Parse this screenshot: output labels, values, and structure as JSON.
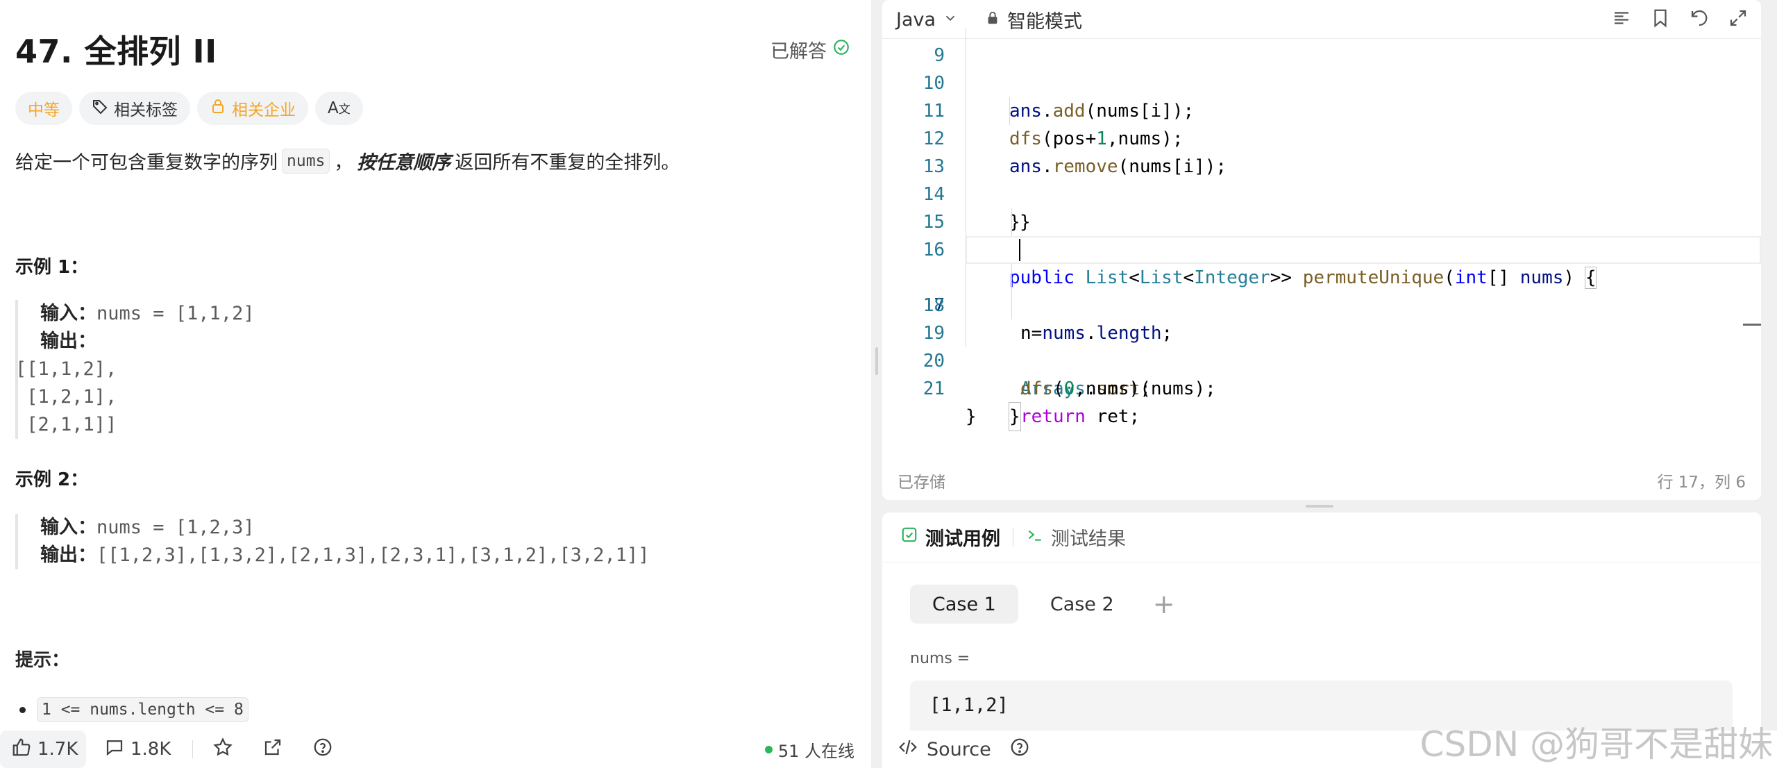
{
  "problem": {
    "title": "47. 全排列 II",
    "solved_label": "已解答",
    "tags": {
      "difficulty": "中等",
      "related_tags": "相关标签",
      "related_companies": "相关企业"
    },
    "desc_prefix": "给定一个可包含重复数字的序列",
    "desc_code": "nums",
    "desc_comma": "，",
    "desc_emphasis": "按任意顺序",
    "desc_suffix": "返回所有不重复的全排列。",
    "example1": {
      "title": "示例 1：",
      "input_label": "输入：",
      "input_value": "nums = [1,1,2]",
      "output_label": "输出：",
      "output_lines": [
        "[[1,1,2],",
        " [1,2,1],",
        " [2,1,1]]"
      ]
    },
    "example2": {
      "title": "示例 2：",
      "input_label": "输入：",
      "input_value": "nums = [1,2,3]",
      "output_label": "输出：",
      "output_value": "[[1,2,3],[1,3,2],[2,1,3],[2,3,1],[3,1,2],[3,2,1]]"
    },
    "hint_title": "提示：",
    "hint_item": "1 <= nums.length <= 8"
  },
  "left_bottom": {
    "likes": "1.7K",
    "comments": "1.8K",
    "online": "51 人在线"
  },
  "editor": {
    "language": "Java",
    "mode": "智能模式",
    "lines": [
      {
        "no": "9",
        "text": "ans.add(nums[i]);"
      },
      {
        "no": "10",
        "text": "dfs(pos+1,nums);"
      },
      {
        "no": "11",
        "text": "ans.remove(nums[i]);"
      },
      {
        "no": "12",
        "text": "}"
      },
      {
        "no": "13",
        "text": "}"
      },
      {
        "no": "14",
        "text": ""
      },
      {
        "no": "15",
        "text": "public List<List<Integer>> permuteUnique(int[] nums) {"
      },
      {
        "no": "16",
        "text": "n=nums.length;"
      },
      {
        "no": "17",
        "text": "Arrays.sort(nums);"
      },
      {
        "no": "18",
        "text": "dfs(0,nums);"
      },
      {
        "no": "19",
        "text": "return ret;"
      },
      {
        "no": "20",
        "text": "}"
      },
      {
        "no": "21",
        "text": "}"
      }
    ],
    "saved_status": "已存储",
    "cursor_position": "行 17，列 6"
  },
  "testpanel": {
    "tab_cases": "测试用例",
    "tab_results": "测试结果",
    "cases": [
      "Case 1",
      "Case 2"
    ],
    "add_label": "+",
    "param_label": "nums =",
    "param_value": "[1,1,2]"
  },
  "right_bottom": {
    "source_label": "Source"
  },
  "watermark": "CSDN @狗哥不是甜妹"
}
